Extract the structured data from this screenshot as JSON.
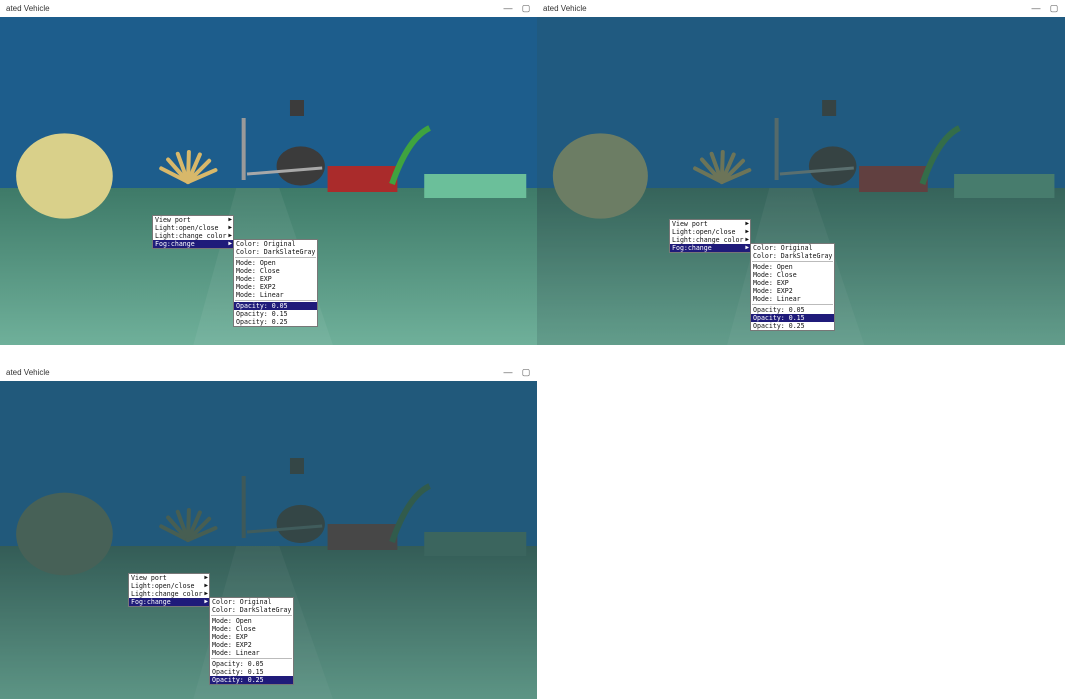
{
  "windows": [
    {
      "title": "ated Vehicle",
      "controls": {
        "minimize": "—",
        "restore": "▢"
      },
      "fog_opacity": 0.05,
      "main_menu": [
        {
          "label": "View port",
          "has_submenu": true
        },
        {
          "label": "Light:open/close",
          "has_submenu": true
        },
        {
          "label": "Light:change color",
          "has_submenu": true
        },
        {
          "label": "Fog:change",
          "has_submenu": true,
          "selected": true
        }
      ],
      "fog_submenu": [
        {
          "label": "Color: Original"
        },
        {
          "label": "Color: DarkSlateGray"
        },
        {
          "label": "Mode: Open"
        },
        {
          "label": "Mode: Close"
        },
        {
          "label": "Mode: EXP"
        },
        {
          "label": "Mode: EXP2"
        },
        {
          "label": "Mode: Linear"
        },
        {
          "label": "Opacity: 0.05",
          "selected": true
        },
        {
          "label": "Opacity: 0.15"
        },
        {
          "label": "Opacity: 0.25"
        }
      ]
    },
    {
      "title": "ated Vehicle",
      "controls": {
        "minimize": "—",
        "restore": "▢"
      },
      "fog_opacity": 0.15,
      "main_menu": [
        {
          "label": "View port",
          "has_submenu": true
        },
        {
          "label": "Light:open/close",
          "has_submenu": true
        },
        {
          "label": "Light:change color",
          "has_submenu": true
        },
        {
          "label": "Fog:change",
          "has_submenu": true,
          "selected": true
        }
      ],
      "fog_submenu": [
        {
          "label": "Color: Original"
        },
        {
          "label": "Color: DarkSlateGray"
        },
        {
          "label": "Mode: Open"
        },
        {
          "label": "Mode: Close"
        },
        {
          "label": "Mode: EXP"
        },
        {
          "label": "Mode: EXP2"
        },
        {
          "label": "Mode: Linear"
        },
        {
          "label": "Opacity: 0.05"
        },
        {
          "label": "Opacity: 0.15",
          "selected": true
        },
        {
          "label": "Opacity: 0.25"
        }
      ]
    },
    {
      "title": "ated Vehicle",
      "controls": {
        "minimize": "—",
        "restore": "▢"
      },
      "fog_opacity": 0.25,
      "main_menu": [
        {
          "label": "View port",
          "has_submenu": true
        },
        {
          "label": "Light:open/close",
          "has_submenu": true
        },
        {
          "label": "Light:change color",
          "has_submenu": true
        },
        {
          "label": "Fog:change",
          "has_submenu": true,
          "selected": true
        }
      ],
      "fog_submenu": [
        {
          "label": "Color: Original"
        },
        {
          "label": "Color: DarkSlateGray"
        },
        {
          "label": "Mode: Open"
        },
        {
          "label": "Mode: Close"
        },
        {
          "label": "Mode: EXP"
        },
        {
          "label": "Mode: EXP2"
        },
        {
          "label": "Mode: Linear"
        },
        {
          "label": "Opacity: 0.05"
        },
        {
          "label": "Opacity: 0.15"
        },
        {
          "label": "Opacity: 0.25",
          "selected": true
        }
      ]
    }
  ],
  "colors": {
    "sky": "#1d5d8c",
    "ground": "#5a9a86",
    "fog": "#2f4f4f",
    "menu_highlight": "#1f1b7a"
  },
  "icons": {
    "submenu_arrow": "▶"
  }
}
